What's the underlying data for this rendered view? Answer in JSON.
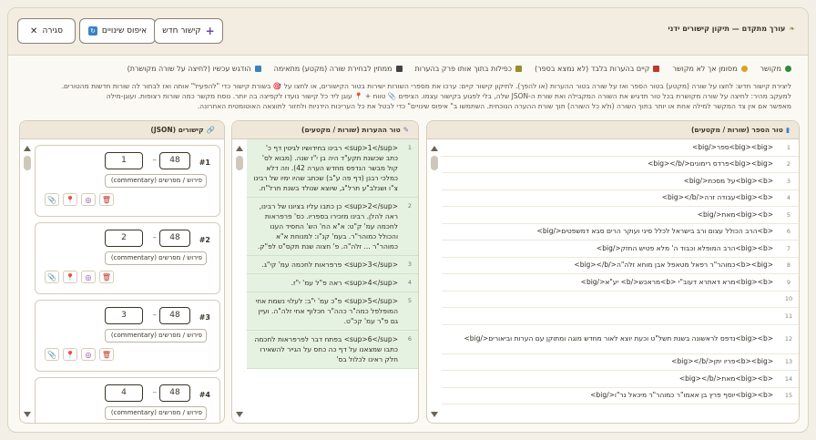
{
  "header": {
    "title": "עורך מתקדם — תיקון קישורים ידני",
    "close_label": "סגירה",
    "reset_label": "איפוס שינויים",
    "new_link_label": "קישור חדש"
  },
  "legend": [
    {
      "label": "מקושר",
      "color": "#2e8b3a",
      "shape": "circle"
    },
    {
      "label": "מסומן אך לא מקושר",
      "color": "#e0a020",
      "shape": "circle"
    },
    {
      "label": "קיים בהערות בלבד (לא נמצא בספר)",
      "color": "#c0392b",
      "shape": "square"
    },
    {
      "label": "כפילות בתוך אותו פרק בהערות",
      "color": "#9b8a2e",
      "shape": "square"
    },
    {
      "label": "ממתין לבחירת שורה (מקטע) מתאימה",
      "color": "#444444",
      "shape": "square"
    },
    {
      "label": "הודגש עכשיו (לחיצה על שורה מקושרת)",
      "color": "#3b82c4",
      "shape": "square"
    }
  ],
  "instructions": [
    "ליצירת קישור חדש: לחצו על שורה (מקטע) בטור הספר ואז על שורה בטור ההערות (או להפך). לתיקון קישור קיים: ערכו את מספרי השורות ישירות בטור הקישורים, או לחצו על 🎯 בשורת קישור כדי \"להפעיל\" אותה ואז לבחור לה שורות חדשות מהטורים.",
    "למעקב מהיר: לחיצה על שורה מקושרת בכל טור תדגיש את השורה המקבילה ואת שורת ה-JSON שלה, בלי לפגוע בקישור עצמו. הציפים 📎 טווח + 📍 עוגן ליד כל קישור נועדו לקפיצה בה יותר. נוסח מקשר כמה שורות רצופות. ועוגן-מילה",
    "מאפשר אם אין צד המקשר למילה אחת או יותר בתוך השורה (ולא כל השורה) תוך שורת ההערה הנוכחית. השתמשו ב\" איפוס שינויים\" כדי לבטל את כל העריכות הידניות ולחזור לתוצאה האוטומטית האחרונה."
  ],
  "panels": {
    "source_title": "טור הספר (שורות / מקטעים)",
    "lines_title": "טור ההערות (שורות / מקטעים)",
    "json_title": "קישורים (JSON)"
  },
  "source_rows": [
    {
      "num": "1",
      "text": "<big><big>ספר</big>"
    },
    {
      "num": "2",
      "text": "<big><big>פרדס רימונים</big></b>"
    },
    {
      "num": "3",
      "text": "<big><b>על מסכת</big>"
    },
    {
      "num": "4",
      "text": "<big><b>עבודה זרה</big></b>"
    },
    {
      "num": "5",
      "text": "<big><b>מאת</big>"
    },
    {
      "num": "6",
      "text": "<b>הרב הכולל עצום ורב בישראל לכלל סיני ועוקר הרים סבא דמשפטים</big>"
    },
    {
      "num": "7",
      "text": "<big><b>הרב המופלא וכבוד ה' מלא פטיש החזק</big>"
    },
    {
      "num": "8",
      "text": "<b><big>כמוהר\"ר רפאל מטאפל אבן מוחא זלה\"ה</big></b>"
    },
    {
      "num": "9",
      "text": "<big><b>מרא דאתרא דעוב\"י <b>מראכש</b> יע\"א</big>"
    },
    {
      "num": "10",
      "text": ""
    },
    {
      "num": "11",
      "text": ""
    },
    {
      "num": "12",
      "text": "<big><b>נדפס לראשונה בשנת תשל\"ט וכעת יוצא לאור מחדש מוגה ומתוקן עם הערות וביאורים</big>"
    },
    {
      "num": "13",
      "text": "<b><big>פריו יתן</big></b>"
    },
    {
      "num": "14",
      "text": "<big><b>מאת</big></b>"
    },
    {
      "num": "15",
      "text": "<big><b>יוסף פרץ בן אאמו\"ר כמוהר\"ר מיכאל נר\"ו</big>"
    }
  ],
  "line_rows": [
    {
      "num": "1",
      "text": "<sup>1</sup> רבינו בחידושיו לגיטין דף כ' כתב שכשנת תקע\"ד היה בן י\"ז שנה. (מבוא לס' קול מבשר הנדפס מחדש הערה 42). וזה דלא כמלכי רבנן (דף פה ע\"ב) שכתב שהיו ימיו של רבינו צ\"ו ושנלב\"ע תרל\"ג, שיוצא שנולד בשנת תרל\"ח."
    },
    {
      "num": "2",
      "text": "<sup>2</sup> כן כתבו עליו בציונו של רבינו, ראה להלן. רבינו מזכירו בספריו. כס' פרפראות לחכמה עמ' ק\"ט: א\"א הח' הש' החסיד הענו והכולל כמוהר\"ר. בעמ' קנ\"ו: למנוחת א\"א כמוהר\"ר ... זלה\"ה. פ' חצוה שנת תקס\"ט לפ\"ק."
    },
    {
      "num": "3",
      "text": "<sup>3</sup> פרפראות לחכמה עמ' קי\"ג."
    },
    {
      "num": "4",
      "text": "<sup>4</sup> ראה פ\"ל עמ' י\"ז."
    },
    {
      "num": "5",
      "text": "<sup>5</sup> פ\"כ עמ' י\"ב: לעלוי נשמת אחי המופלפל כמה\"ר כהה\"ר חכלוף אחי זלה\"ה. ועיין גם פ\"ר עמ' קכ\"ט."
    },
    {
      "num": "6",
      "text": "<sup>6</sup> בפתח דבר לפרפראות לחכמה כתבו שמצאנו על דף כה כחס על הגייר להשאירו חלק ראינו לכלול בס'"
    }
  ],
  "json_links": [
    {
      "idx": "#1",
      "from": "48",
      "to": "1",
      "type": "פירוש / מפרשים (commentary)"
    },
    {
      "idx": "#2",
      "from": "48",
      "to": "2",
      "type": "פירוש / מפרשים (commentary)"
    },
    {
      "idx": "#3",
      "from": "48",
      "to": "3",
      "type": "פירוש / מפרשים (commentary)"
    },
    {
      "idx": "#4",
      "from": "48",
      "to": "4",
      "type": "פירוש / מפרשים (commentary)"
    }
  ]
}
